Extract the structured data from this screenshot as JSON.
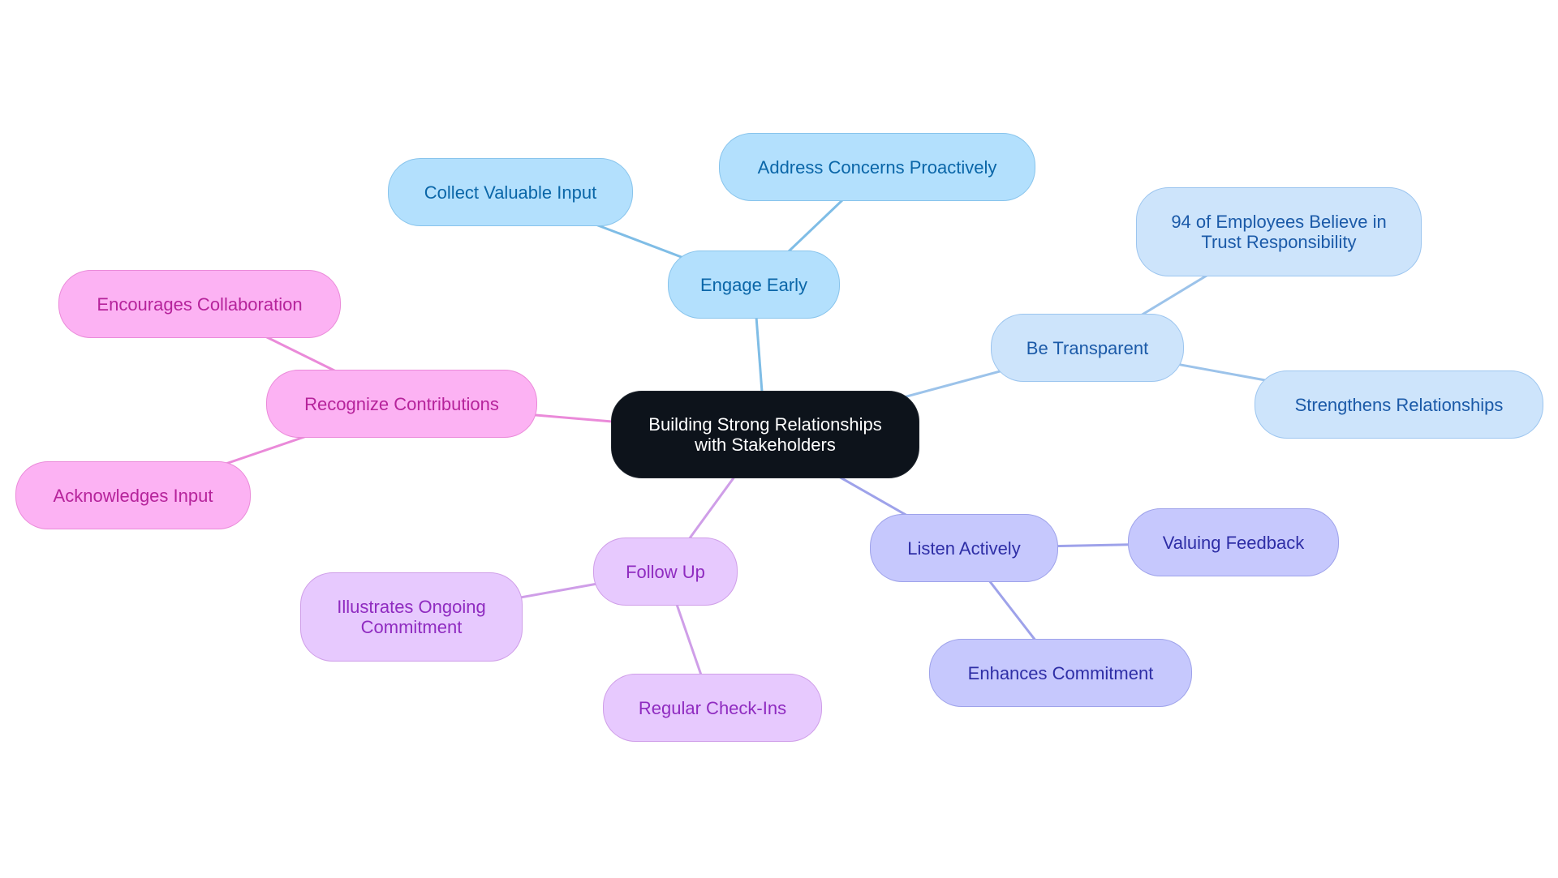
{
  "diagram": {
    "type": "mindmap",
    "root": {
      "id": "root",
      "label_lines": [
        "Building Strong Relationships",
        "with Stakeholders"
      ]
    },
    "branches": [
      {
        "id": "engage",
        "label": "Engage Early",
        "color_group": "blue",
        "line_color": "#7fbde6",
        "children": [
          {
            "id": "collect",
            "label": "Collect Valuable Input"
          },
          {
            "id": "address",
            "label": "Address Concerns Proactively"
          }
        ]
      },
      {
        "id": "transparent",
        "label": "Be Transparent",
        "color_group": "lblue",
        "line_color": "#9cc3ea",
        "children": [
          {
            "id": "employees",
            "label_lines": [
              "94 of Employees Believe in",
              "Trust Responsibility"
            ]
          },
          {
            "id": "strengthens",
            "label": "Strengthens Relationships"
          }
        ]
      },
      {
        "id": "listen",
        "label": "Listen Actively",
        "color_group": "indigo",
        "line_color": "#9ea2ea",
        "children": [
          {
            "id": "valuing",
            "label": "Valuing Feedback"
          },
          {
            "id": "enhances",
            "label": "Enhances Commitment"
          }
        ]
      },
      {
        "id": "followup",
        "label": "Follow Up",
        "color_group": "purple",
        "line_color": "#cf9ee8",
        "children": [
          {
            "id": "illustrates",
            "label_lines": [
              "Illustrates Ongoing",
              "Commitment"
            ]
          },
          {
            "id": "checkins",
            "label": "Regular Check-Ins"
          }
        ]
      },
      {
        "id": "recognize",
        "label": "Recognize Contributions",
        "color_group": "pink",
        "line_color": "#ea8ad9",
        "children": [
          {
            "id": "encourages",
            "label": "Encourages Collaboration"
          },
          {
            "id": "acknowledges",
            "label": "Acknowledges Input"
          }
        ]
      }
    ]
  }
}
